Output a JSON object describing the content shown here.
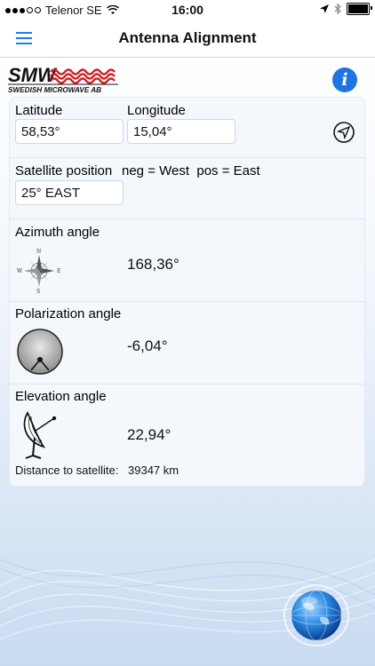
{
  "status_bar": {
    "carrier": "Telenor SE",
    "time": "16:00"
  },
  "nav": {
    "title": "Antenna Alignment"
  },
  "logo": {
    "brand": "SMW",
    "tagline": "SWEDISH MICROWAVE AB"
  },
  "info_button": {
    "glyph": "i"
  },
  "location": {
    "latitude_label": "Latitude",
    "latitude_value": "58,53°",
    "longitude_label": "Longitude",
    "longitude_value": "15,04°"
  },
  "satellite": {
    "label": "Satellite position",
    "hint": "neg = West  pos = East",
    "value": "25° EAST"
  },
  "azimuth": {
    "label": "Azimuth angle",
    "value": "168,36°",
    "compass_letters": {
      "n": "N",
      "s": "S",
      "e": "E",
      "w": "W"
    }
  },
  "polarization": {
    "label": "Polarization angle",
    "value": "-6,04°"
  },
  "elevation": {
    "label": "Elevation angle",
    "value": "22,94°"
  },
  "distance": {
    "label": "Distance to satellite:",
    "value": "39347 km"
  },
  "colors": {
    "accent": "#1e7cf0",
    "info": "#1e74e2",
    "logo_red": "#d21f26"
  }
}
